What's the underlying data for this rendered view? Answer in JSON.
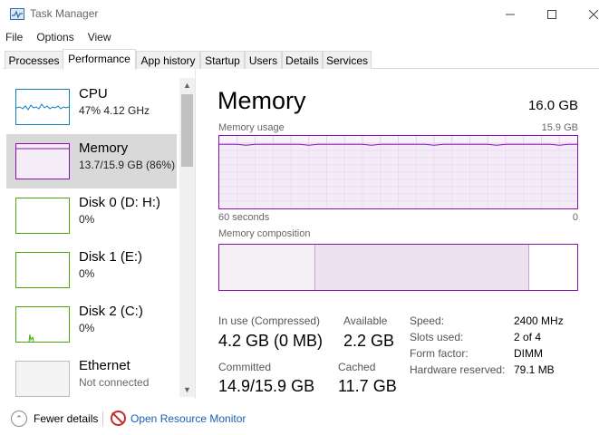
{
  "window": {
    "title": "Task Manager"
  },
  "menu": [
    "File",
    "Options",
    "View"
  ],
  "tabs": [
    "Processes",
    "Performance",
    "App history",
    "Startup",
    "Users",
    "Details",
    "Services"
  ],
  "active_tab": "Performance",
  "sidebar": {
    "items": [
      {
        "title": "CPU",
        "subtitle": "47%  4.12 GHz",
        "color": "#117dbb"
      },
      {
        "title": "Memory",
        "subtitle": "13.7/15.9 GB (86%)",
        "color": "#8b12ae"
      },
      {
        "title": "Disk 0 (D: H:)",
        "subtitle": "0%",
        "color": "#4da60c"
      },
      {
        "title": "Disk 1 (E:)",
        "subtitle": "0%",
        "color": "#4da60c"
      },
      {
        "title": "Disk 2 (C:)",
        "subtitle": "0%",
        "color": "#4da60c"
      },
      {
        "title": "Ethernet",
        "subtitle": "Not connected",
        "color": "#a74f01"
      }
    ]
  },
  "main": {
    "title": "Memory",
    "total": "16.0 GB",
    "usage_label": "Memory usage",
    "usage_max": "15.9 GB",
    "axis_left": "60 seconds",
    "axis_right": "0",
    "composition_label": "Memory composition",
    "usage_fraction": 0.86,
    "composition_fractions": {
      "in_use": 0.265,
      "modified": 0.0,
      "standby": 0.6,
      "free": 0.135
    },
    "stats": {
      "in_use_label": "In use (Compressed)",
      "in_use_value": "4.2 GB (0 MB)",
      "available_label": "Available",
      "available_value": "2.2 GB",
      "committed_label": "Committed",
      "committed_value": "14.9/15.9 GB",
      "cached_label": "Cached",
      "cached_value": "11.7 GB"
    },
    "details": [
      {
        "label": "Speed:",
        "value": "2400 MHz"
      },
      {
        "label": "Slots used:",
        "value": "2 of 4"
      },
      {
        "label": "Form factor:",
        "value": "DIMM"
      },
      {
        "label": "Hardware reserved:",
        "value": "79.1 MB"
      }
    ]
  },
  "footer": {
    "fewer_details": "Fewer details",
    "open_monitor": "Open Resource Monitor"
  },
  "colors": {
    "memory_accent": "#8b12ae",
    "link": "#1a5fb4"
  }
}
